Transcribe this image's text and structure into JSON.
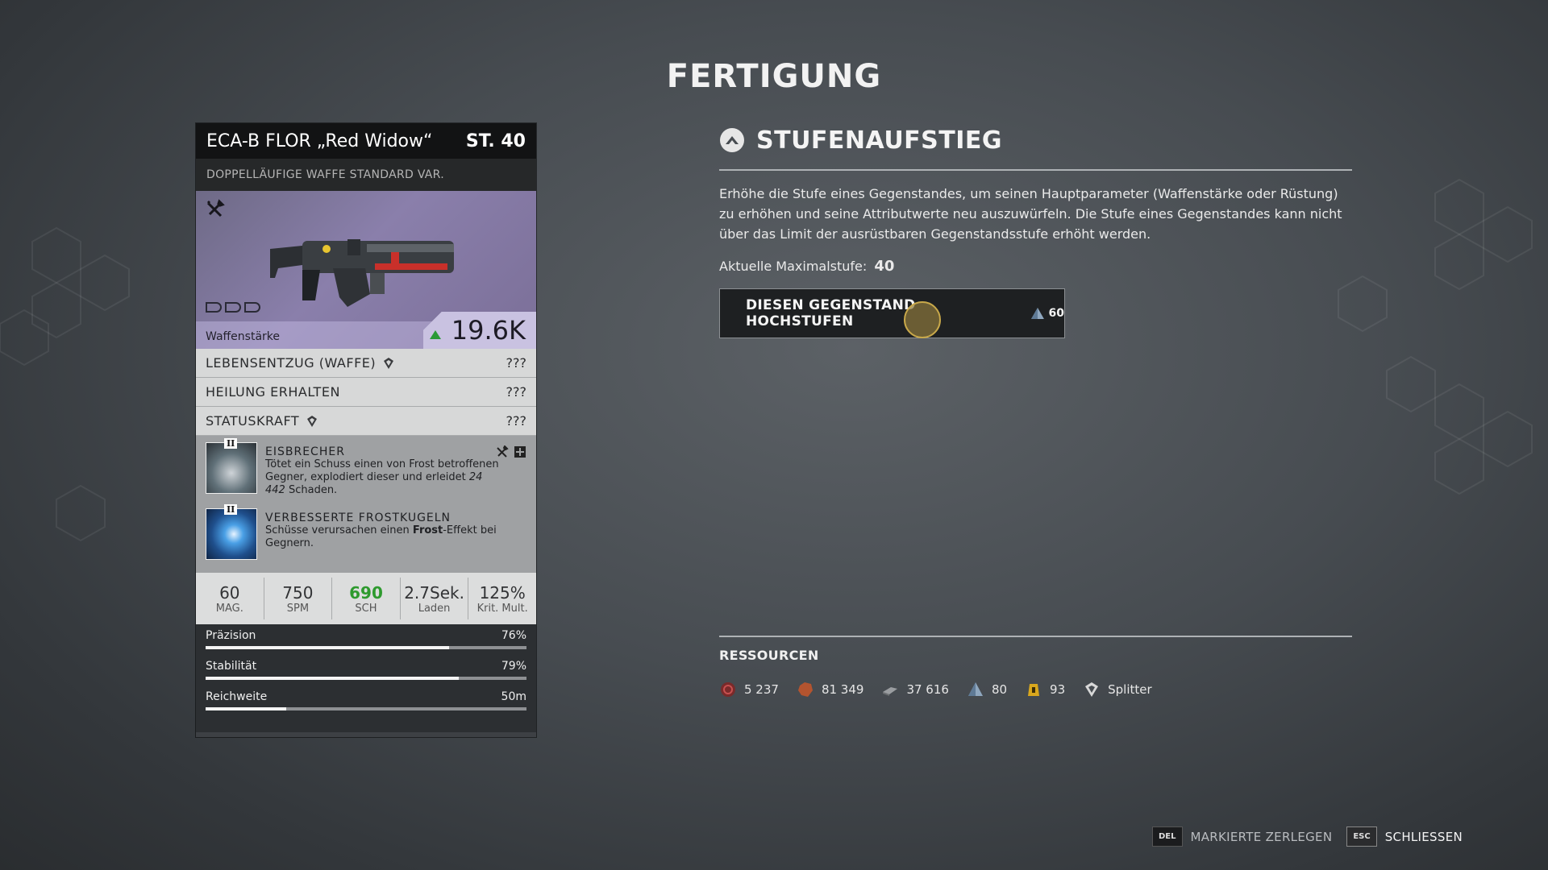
{
  "page": {
    "title": "FERTIGUNG"
  },
  "item": {
    "name": "ECA-B FLOR „Red Widow“",
    "level": "ST. 40",
    "type": "DOPPELLÄUFIGE WAFFE STANDARD VAR.",
    "power_label": "Waffenstärke",
    "power_value": "19.6K",
    "attributes": [
      {
        "name": "LEBENSENTZUG (WAFFE)",
        "value": "???",
        "icon": "shard-icon"
      },
      {
        "name": "HEILUNG ERHALTEN",
        "value": "???"
      },
      {
        "name": "STATUSKRAFT",
        "value": "???",
        "icon": "shard-icon"
      }
    ],
    "mods": [
      {
        "tier": "II",
        "title": "EISBRECHER",
        "desc_a": "Tötet ein Schuss einen von Frost betroffenen Gegner, explodiert dieser und erleidet ",
        "desc_b": "24 442",
        "desc_c": " Schaden."
      },
      {
        "tier": "II",
        "title": "VERBESSERTE FROSTKUGELN",
        "desc_a": "Schüsse verursachen einen ",
        "desc_b": "Frost",
        "desc_c": "-Effekt bei Gegnern."
      }
    ],
    "stats": [
      {
        "value": "60",
        "label": "MAG."
      },
      {
        "value": "750",
        "label": "SPM"
      },
      {
        "value": "690",
        "label": "SCH"
      },
      {
        "value": "2.7Sek.",
        "label": "Laden"
      },
      {
        "value": "125%",
        "label": "Krit. Mult."
      }
    ],
    "bars": [
      {
        "label": "Präzision",
        "value": "76%",
        "fraction": 0.76
      },
      {
        "label": "Stabilität",
        "value": "79%",
        "fraction": 0.79
      },
      {
        "label": "Reichweite",
        "value": "50m",
        "fraction": 0.25
      }
    ]
  },
  "upgrade": {
    "title": "STUFENAUFSTIEG",
    "description": "Erhöhe die Stufe eines Gegenstandes, um seinen Hauptparameter (Waffenstärke oder Rüstung) zu erhöhen und seine Attributwerte neu auszuwürfeln. Die Stufe eines Gegenstandes kann nicht über das Limit der ausrüstbaren Gegenstandsstufe erhöht werden.",
    "max_level_label": "Aktuelle Maximalstufe:",
    "max_level_value": "40",
    "button_label": "DIESEN GEGENSTAND HOCHSTUFEN",
    "cost": "60"
  },
  "resources": {
    "title": "RESSOURCEN",
    "items": [
      {
        "icon": "scrap-icon",
        "value": "5 237"
      },
      {
        "icon": "leather-icon",
        "value": "81 349"
      },
      {
        "icon": "iron-icon",
        "value": "37 616"
      },
      {
        "icon": "titanium-icon",
        "value": "80"
      },
      {
        "icon": "anomalous-power-icon",
        "value": "93"
      },
      {
        "icon": "shard-icon",
        "value": "Splitter"
      }
    ]
  },
  "footer": {
    "dismantle_key": "DEL",
    "dismantle_label": "MARKIERTE ZERLEGEN",
    "close_key": "ESC",
    "close_label": "SCHLIESSEN"
  },
  "colors": {
    "background": "#474c51",
    "card_header": "#121314",
    "item_art": "#8a7fab",
    "stat_highlight": "#2e9a2e",
    "cursor": "#c8a84a"
  }
}
